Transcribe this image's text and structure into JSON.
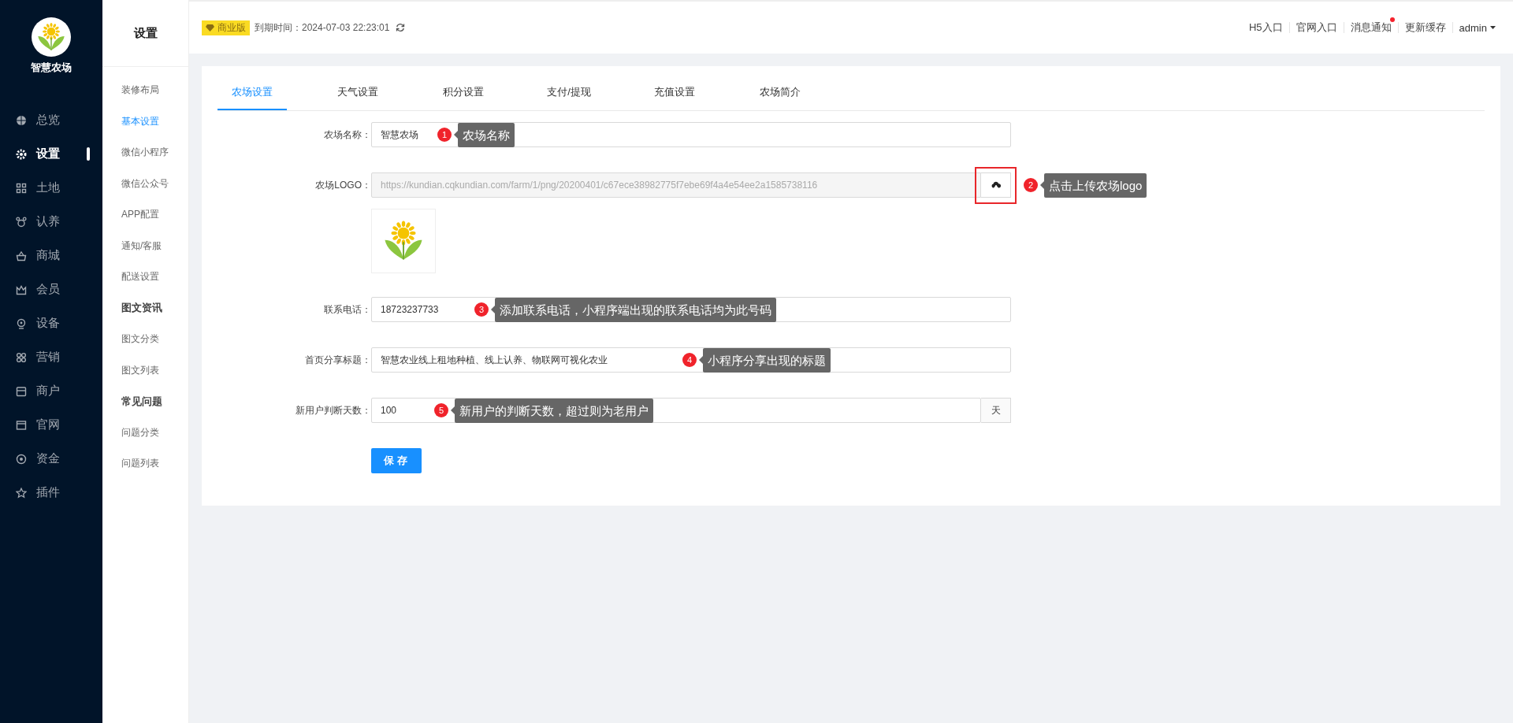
{
  "brand": {
    "name": "智慧农场"
  },
  "nav": [
    {
      "label": "总览",
      "selected": false
    },
    {
      "label": "设置",
      "selected": true
    },
    {
      "label": "土地",
      "selected": false
    },
    {
      "label": "认养",
      "selected": false
    },
    {
      "label": "商城",
      "selected": false
    },
    {
      "label": "会员",
      "selected": false
    },
    {
      "label": "设备",
      "selected": false
    },
    {
      "label": "营销",
      "selected": false
    },
    {
      "label": "商户",
      "selected": false
    },
    {
      "label": "官网",
      "selected": false
    },
    {
      "label": "资金",
      "selected": false
    },
    {
      "label": "插件",
      "selected": false
    }
  ],
  "submenu": {
    "title": "设置",
    "items": [
      {
        "label": "装修布局",
        "kind": "link",
        "selected": false
      },
      {
        "label": "基本设置",
        "kind": "link",
        "selected": true
      },
      {
        "label": "微信小程序",
        "kind": "link",
        "selected": false
      },
      {
        "label": "微信公众号",
        "kind": "link",
        "selected": false
      },
      {
        "label": "APP配置",
        "kind": "link",
        "selected": false
      },
      {
        "label": "通知/客服",
        "kind": "link",
        "selected": false
      },
      {
        "label": "配送设置",
        "kind": "link",
        "selected": false
      },
      {
        "label": "图文资讯",
        "kind": "heading"
      },
      {
        "label": "图文分类",
        "kind": "link",
        "selected": false
      },
      {
        "label": "图文列表",
        "kind": "link",
        "selected": false
      },
      {
        "label": "常见问题",
        "kind": "heading"
      },
      {
        "label": "问题分类",
        "kind": "link",
        "selected": false
      },
      {
        "label": "问题列表",
        "kind": "link",
        "selected": false
      }
    ]
  },
  "header": {
    "edition": "商业版",
    "expiry": "到期时间：2024-07-03 22:23:01",
    "links": [
      {
        "label": "H5入口",
        "badge": false
      },
      {
        "label": "官网入口",
        "badge": false
      },
      {
        "label": "消息通知",
        "badge": true
      },
      {
        "label": "更新缓存",
        "badge": false
      }
    ],
    "user": "admin"
  },
  "tabs": [
    {
      "label": "农场设置",
      "selected": true
    },
    {
      "label": "天气设置",
      "selected": false
    },
    {
      "label": "积分设置",
      "selected": false
    },
    {
      "label": "支付/提现",
      "selected": false
    },
    {
      "label": "充值设置",
      "selected": false
    },
    {
      "label": "农场简介",
      "selected": false
    }
  ],
  "form": {
    "fields": [
      {
        "kind": "text",
        "label": "农场名称：",
        "value": "智慧农场",
        "annotation": {
          "number": "1",
          "text": "农场名称"
        }
      },
      {
        "kind": "upload",
        "label": "农场LOGO：",
        "value": "https://kundian.cqkundian.com/farm/1/png/20200401/c67ece38982775f7ebe69f4a4e54ee2a1585738116",
        "annotation": {
          "number": "2",
          "text": "点击上传农场logo"
        }
      },
      {
        "kind": "text",
        "label": "联系电话：",
        "value": "18723237733",
        "annotation": {
          "number": "3",
          "text": "添加联系电话，小程序端出现的联系电话均为此号码"
        }
      },
      {
        "kind": "text",
        "label": "首页分享标题：",
        "value": "智慧农业线上租地种植、线上认养、物联网可视化农业",
        "annotation": {
          "number": "4",
          "text": "小程序分享出现的标题"
        }
      },
      {
        "kind": "suffix",
        "label": "新用户判断天数：",
        "value": "100",
        "suffix": "天",
        "annotation": {
          "number": "5",
          "text": "新用户的判断天数，超过则为老用户"
        }
      }
    ],
    "save": "保存"
  }
}
